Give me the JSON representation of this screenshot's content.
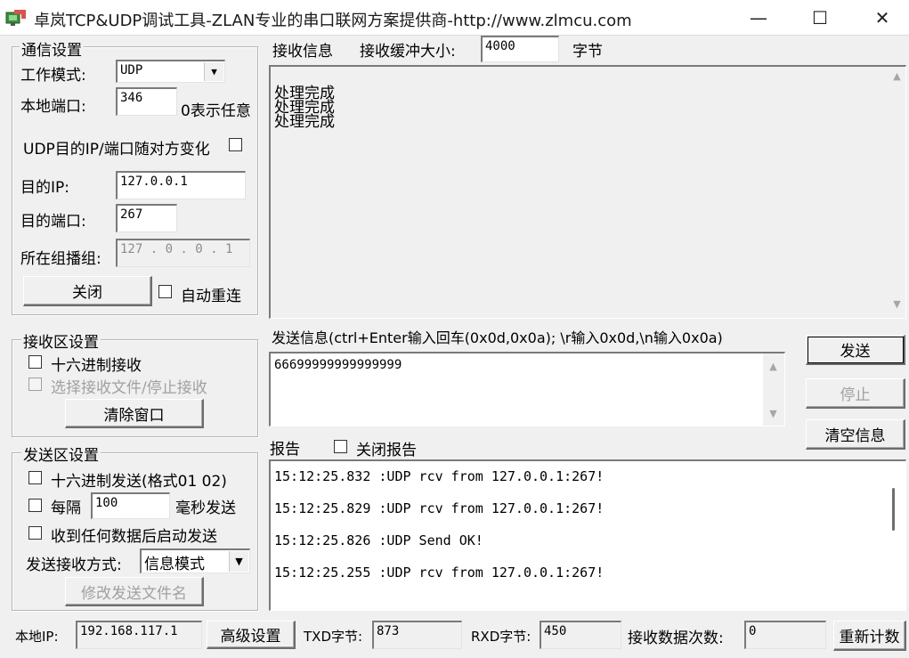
{
  "window": {
    "title": "卓岚TCP&UDP调试工具-ZLAN专业的串口联网方案提供商-http://www.zlmcu.com",
    "minimize": "—",
    "maximize": "☐",
    "close": "✕"
  },
  "comm": {
    "legend": "通信设置",
    "mode_label": "工作模式:",
    "mode_value": "UDP",
    "local_port_label": "本地端口:",
    "local_port_value": "346",
    "local_port_hint": "0表示任意",
    "udp_follow_label": "UDP目的IP/端口随对方变化",
    "dest_ip_label": "目的IP:",
    "dest_ip_value": "127.0.0.1",
    "dest_port_label": "目的端口:",
    "dest_port_value": "267",
    "group_label": "所在组播组:",
    "group_value": "127 . 0  . 0  . 1",
    "close_button": "关闭",
    "auto_reconnect_label": "自动重连"
  },
  "recv_settings": {
    "legend": "接收区设置",
    "hex_recv_label": "十六进制接收",
    "select_file_label": "选择接收文件/停止接收",
    "clear_button": "清除窗口"
  },
  "send_settings": {
    "legend": "发送区设置",
    "hex_send_label": "十六进制发送(格式01 02)",
    "interval_prefix": "每隔",
    "interval_value": "100",
    "interval_suffix": "毫秒发送",
    "auto_send_label": "收到任何数据后启动发送",
    "send_mode_label": "发送接收方式:",
    "send_mode_value": "信息模式",
    "modify_file_button": "修改发送文件名"
  },
  "recv_info": {
    "label": "接收信息",
    "buffer_label": "接收缓冲大小:",
    "buffer_value": "4000",
    "buffer_unit": "字节",
    "lines": [
      "处理完成",
      "处理完成",
      "处理完成"
    ]
  },
  "send_info": {
    "label": "发送信息(ctrl+Enter输入回车(0x0d,0x0a); \\r输入0x0d,\\n输入0x0a)",
    "text": "66699999999999999",
    "send_button": "发送",
    "stop_button": "停止",
    "clear_info_button": "清空信息"
  },
  "report": {
    "label": "报告",
    "close_report_label": "关闭报告",
    "lines": [
      "15:12:25.832 :UDP rcv from 127.0.0.1:267!",
      "15:12:25.829 :UDP rcv from 127.0.0.1:267!",
      "15:12:25.826 :UDP Send OK!",
      "15:12:25.255 :UDP rcv from 127.0.0.1:267!"
    ]
  },
  "status": {
    "local_ip_label": "本地IP:",
    "local_ip_value": "192.168.117.1",
    "advanced_button": "高级设置",
    "txd_label": "TXD字节:",
    "txd_value": "873",
    "rxd_label": "RXD字节:",
    "rxd_value": "450",
    "recv_count_label": "接收数据次数:",
    "recv_count_value": "0",
    "reset_button": "重新计数"
  },
  "colors": {
    "window_bg": "#f0f0f0",
    "field_bg": "#ffffff"
  }
}
